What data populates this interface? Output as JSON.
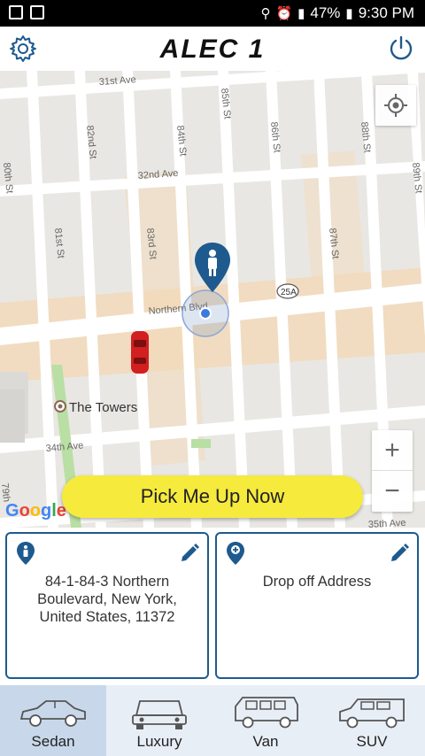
{
  "status_bar": {
    "battery": "47%",
    "time": "9:30 PM"
  },
  "header": {
    "title": "ALEC 1"
  },
  "map": {
    "streets": [
      "31st Ave",
      "82nd St",
      "84th St",
      "85th St",
      "86th St",
      "88th St",
      "89th St",
      "80th St",
      "32nd Ave",
      "81st St",
      "83rd St",
      "87th St",
      "Northern Blvd",
      "25A",
      "34th Ave",
      "35th Ave",
      "79th"
    ],
    "place": "The Towers",
    "attribution": "Google"
  },
  "pickup_button": {
    "label": "Pick Me Up Now"
  },
  "pickup_address": {
    "text": "84-1-84-3 Northern Boulevard, New York, United States, 11372"
  },
  "dropoff_address": {
    "text": "Drop off Address"
  },
  "vehicle_tabs": [
    {
      "label": "Sedan",
      "selected": true
    },
    {
      "label": "Luxury",
      "selected": false
    },
    {
      "label": "Van",
      "selected": false
    },
    {
      "label": "SUV",
      "selected": false
    }
  ],
  "colors": {
    "accent": "#1e5a8e",
    "button": "#f6ea3d",
    "car": "#d21f1f"
  }
}
